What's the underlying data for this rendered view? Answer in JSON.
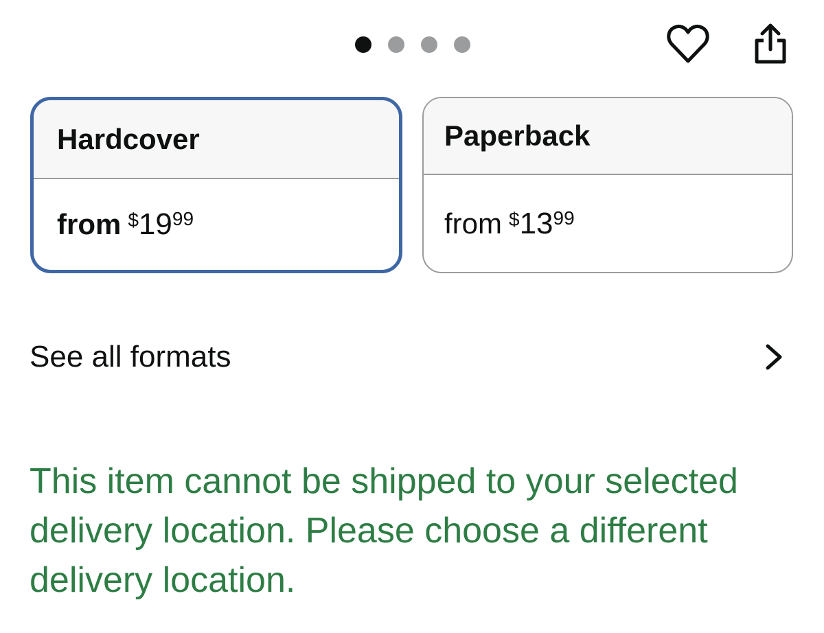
{
  "carousel": {
    "dot_count": 4,
    "active_index": 0
  },
  "actions": {
    "favorite_icon": "heart-icon",
    "share_icon": "share-icon"
  },
  "formats": [
    {
      "name": "Hardcover",
      "from_label": "from",
      "currency": "$",
      "price_whole": "19",
      "price_cents": "99",
      "selected": true
    },
    {
      "name": "Paperback",
      "from_label": "from",
      "currency": "$",
      "price_whole": "13",
      "price_cents": "99",
      "selected": false
    }
  ],
  "see_all": {
    "label": "See all formats",
    "icon": "chevron-right-icon"
  },
  "notice": {
    "text": "This item cannot be shipped to your selected delivery location. Please choose a different delivery location."
  },
  "colors": {
    "selected_border": "#3f67a5",
    "notice_green": "#2e7d45",
    "dot_inactive": "#9a9c9e"
  }
}
